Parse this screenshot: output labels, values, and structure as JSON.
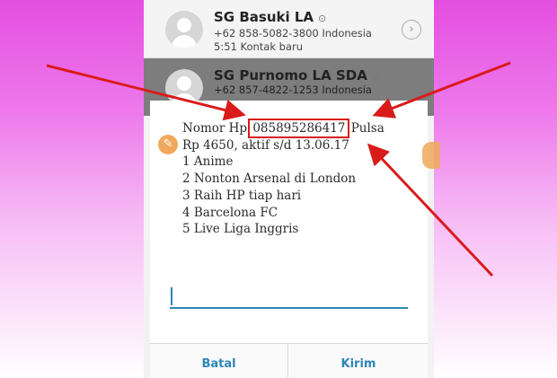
{
  "contacts": [
    {
      "name": "SG Basuki LA",
      "line1": "+62 858-5082-3800 Indonesia",
      "line2": "5:51 Kontak baru"
    },
    {
      "name": "SG Purnomo LA SDA",
      "line1": "+62 857-4822-1253 Indonesia"
    }
  ],
  "dialog": {
    "line1_prefix": "Nomor Hp",
    "phone_number": "085895286417",
    "line1_suffix": "Pulsa",
    "line2": "Rp 4650, aktif s/d 13.06.17",
    "options": [
      "1 Anime",
      "2 Nonton Arsenal di London",
      "3 Raih HP tiap hari",
      "4 Barcelona FC",
      "5 Live Liga Inggris"
    ],
    "input_value": "",
    "cancel_label": "Batal",
    "send_label": "Kirim"
  },
  "colors": {
    "accent": "#2d86b6",
    "highlight": "#d91b1b",
    "background_top": "#e44fe0"
  },
  "icons": {
    "brush": "paintbrush-icon",
    "chevron": "chevron-right-icon",
    "avatar": "person-icon"
  }
}
